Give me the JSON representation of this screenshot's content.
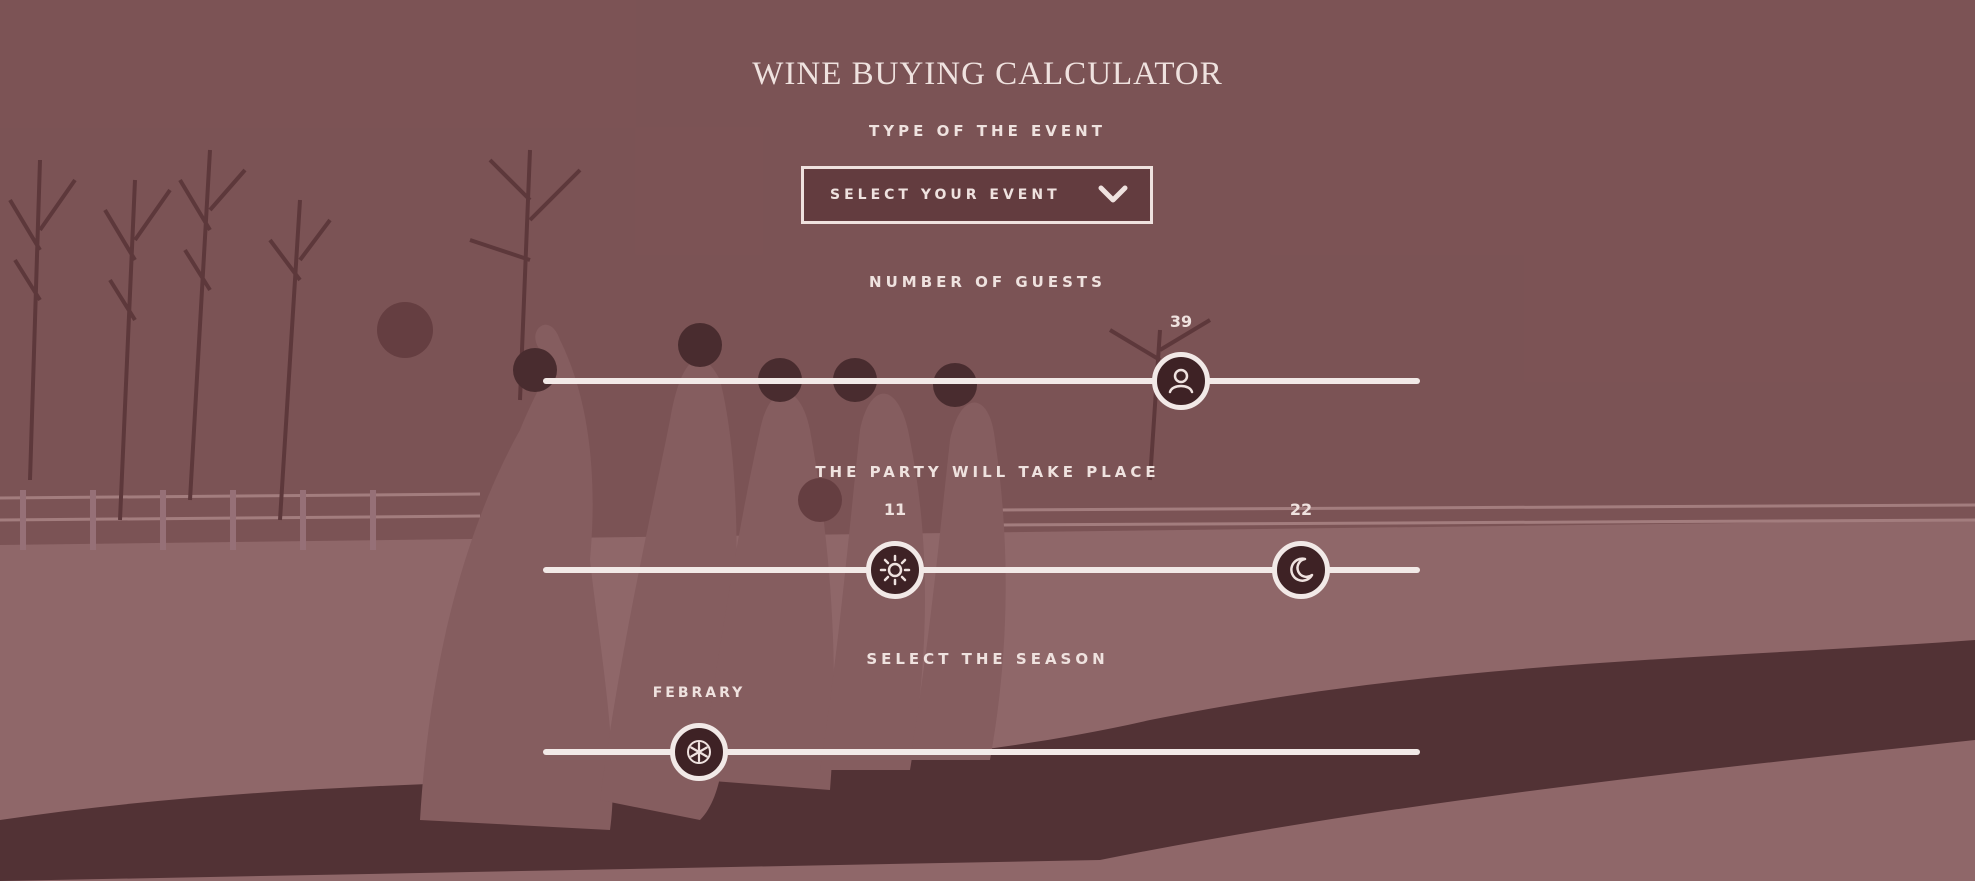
{
  "title": "WINE BUYING CALCULATOR",
  "event": {
    "label": "TYPE OF THE EVENT",
    "placeholder": "SELECT YOUR EVENT",
    "icon": "chevron-down-icon"
  },
  "guests": {
    "label": "NUMBER OF GUESTS",
    "value": "39",
    "icon": "person-icon"
  },
  "party_time": {
    "label": "THE PARTY WILL TAKE PLACE",
    "start": "11",
    "end": "22",
    "start_icon": "sun-icon",
    "end_icon": "moon-icon"
  },
  "season": {
    "label": "SELECT THE SEASON",
    "value": "FEBRARY",
    "icon": "snowflake-icon"
  },
  "colors": {
    "tint": "#7c5556",
    "foreground": "#efe2df",
    "thumb_fill": "#3e2225"
  }
}
